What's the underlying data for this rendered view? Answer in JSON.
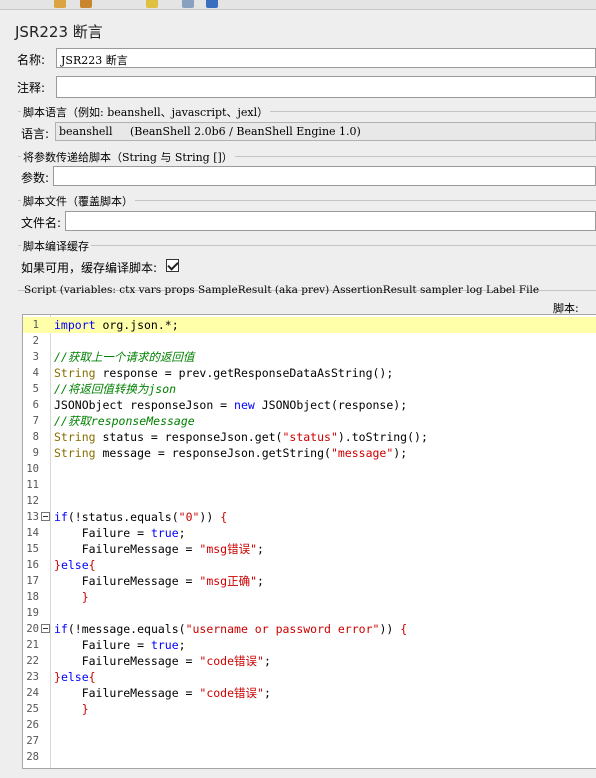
{
  "colors": {
    "highlight_line": "#ffffaa",
    "keyword": "#0000ff",
    "comment": "#008000",
    "string": "#cc0000"
  },
  "header": {
    "title": "JSR223 断言"
  },
  "form": {
    "name_label": "名称:",
    "name_value": "JSR223 断言",
    "comment_label": "注释:",
    "comment_value": ""
  },
  "language_section": {
    "title": "脚本语言（例如: beanshell、javascript、jexl）",
    "label": "语言:",
    "value": "beanshell     (BeanShell 2.0b6 / BeanShell Engine 1.0)"
  },
  "params_section": {
    "title": "将参数传递给脚本（String 与 String []）",
    "label": "参数:",
    "value": ""
  },
  "file_section": {
    "title": "脚本文件（覆盖脚本）",
    "label": "文件名:",
    "value": ""
  },
  "cache_section": {
    "title": "脚本编译缓存",
    "label": "如果可用，缓存编译脚本:",
    "checked": true
  },
  "script_section": {
    "caption": "Script (variables: ctx vars props SampleResult (aka prev) AssertionResult sampler log Label File",
    "label": "脚本:"
  },
  "editor": {
    "lines": [
      {
        "n": "1",
        "fold": false,
        "hl": true,
        "code": "import org.json.*;"
      },
      {
        "n": "2",
        "fold": false,
        "hl": false,
        "code": ""
      },
      {
        "n": "3",
        "fold": false,
        "hl": false,
        "code": "//获取上一个请求的返回值"
      },
      {
        "n": "4",
        "fold": false,
        "hl": false,
        "code": "String response = prev.getResponseDataAsString();"
      },
      {
        "n": "5",
        "fold": false,
        "hl": false,
        "code": "//将返回值转换为json"
      },
      {
        "n": "6",
        "fold": false,
        "hl": false,
        "code": "JSONObject responseJson = new JSONObject(response);"
      },
      {
        "n": "7",
        "fold": false,
        "hl": false,
        "code": "//获取responseMessage"
      },
      {
        "n": "8",
        "fold": false,
        "hl": false,
        "code": "String status = responseJson.get(\"status\").toString();"
      },
      {
        "n": "9",
        "fold": false,
        "hl": false,
        "code": "String message = responseJson.getString(\"message\");"
      },
      {
        "n": "10",
        "fold": false,
        "hl": false,
        "code": ""
      },
      {
        "n": "11",
        "fold": false,
        "hl": false,
        "code": ""
      },
      {
        "n": "12",
        "fold": false,
        "hl": false,
        "code": ""
      },
      {
        "n": "13",
        "fold": true,
        "hl": false,
        "code": "if(!status.equals(\"0\")) {"
      },
      {
        "n": "14",
        "fold": false,
        "hl": false,
        "code": "    Failure = true;"
      },
      {
        "n": "15",
        "fold": false,
        "hl": false,
        "code": "    FailureMessage = \"msg错误\";"
      },
      {
        "n": "16",
        "fold": false,
        "hl": false,
        "code": "}else{"
      },
      {
        "n": "17",
        "fold": false,
        "hl": false,
        "code": "    FailureMessage = \"msg正确\";"
      },
      {
        "n": "18",
        "fold": false,
        "hl": false,
        "code": "    }"
      },
      {
        "n": "19",
        "fold": false,
        "hl": false,
        "code": ""
      },
      {
        "n": "20",
        "fold": true,
        "hl": false,
        "code": "if(!message.equals(\"username or password error\")) {"
      },
      {
        "n": "21",
        "fold": false,
        "hl": false,
        "code": "    Failure = true;"
      },
      {
        "n": "22",
        "fold": false,
        "hl": false,
        "code": "    FailureMessage = \"code错误\";"
      },
      {
        "n": "23",
        "fold": false,
        "hl": false,
        "code": "}else{"
      },
      {
        "n": "24",
        "fold": false,
        "hl": false,
        "code": "    FailureMessage = \"code错误\";"
      },
      {
        "n": "25",
        "fold": false,
        "hl": false,
        "code": "    }"
      },
      {
        "n": "26",
        "fold": false,
        "hl": false,
        "code": ""
      },
      {
        "n": "27",
        "fold": false,
        "hl": false,
        "code": ""
      },
      {
        "n": "28",
        "fold": false,
        "hl": false,
        "code": ""
      }
    ]
  }
}
